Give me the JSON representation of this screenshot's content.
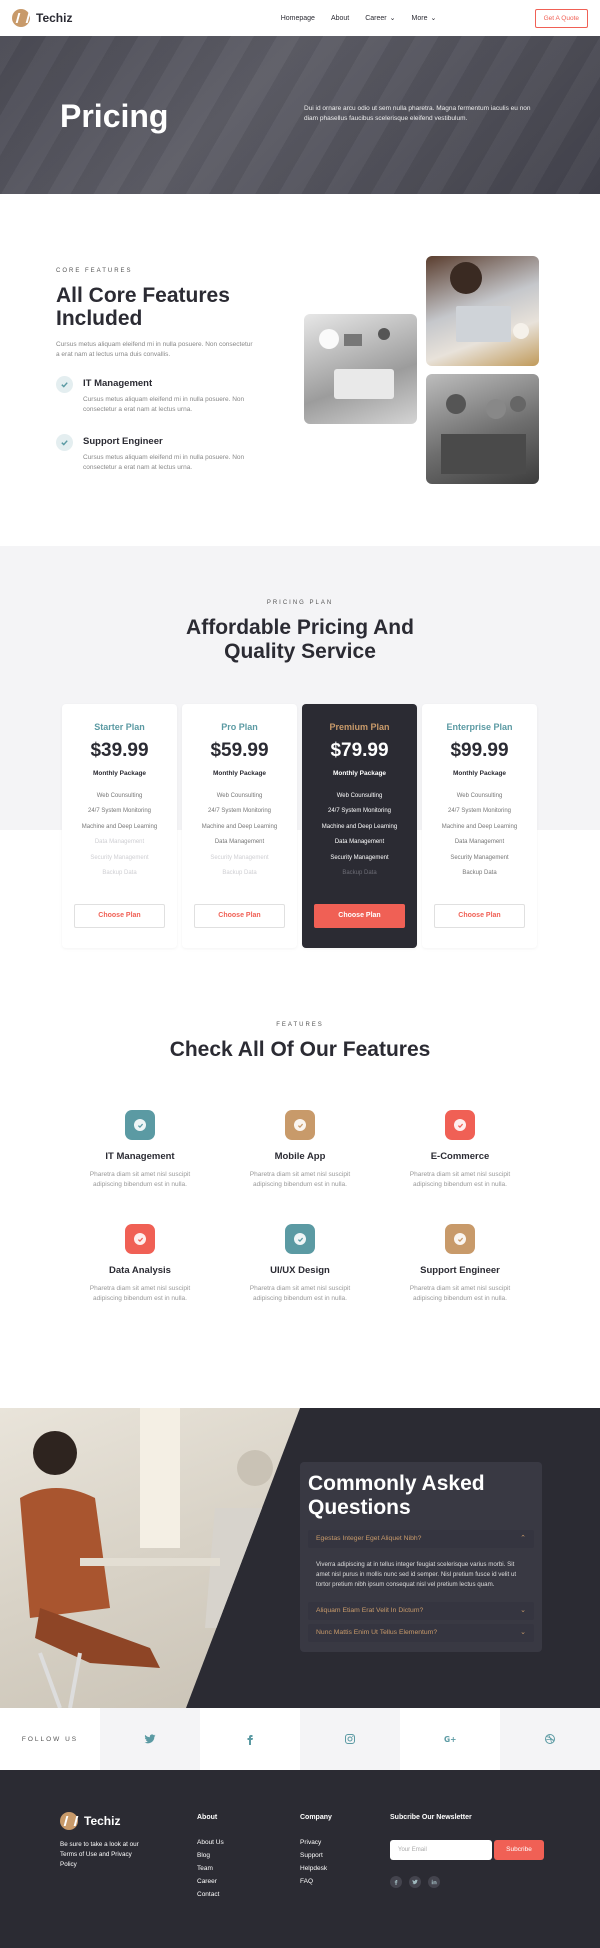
{
  "header": {
    "brand": "Techiz",
    "nav": [
      "Homepage",
      "About",
      "Career",
      "More"
    ],
    "cta": "Get A Quote"
  },
  "hero": {
    "title": "Pricing",
    "subtitle": "Dui id ornare arcu odio ut sem nulla pharetra. Magna fermentum iaculis eu non diam phasellus faucibus scelerisque eleifend vestibulum."
  },
  "core": {
    "eyebrow": "CORE FEATURES",
    "title": "All Core Features Included",
    "description": "Cursus metus aliquam eleifend mi in nulla posuere. Non consectetur a erat nam at lectus urna duis convallis.",
    "items": [
      {
        "title": "IT Management",
        "text": "Cursus metus aliquam eleifend mi in nulla posuere. Non consectetur a erat nam at lectus urna."
      },
      {
        "title": "Support Engineer",
        "text": "Cursus metus aliquam eleifend mi in nulla posuere. Non consectetur a erat nam at lectus urna."
      }
    ]
  },
  "pricing": {
    "eyebrow": "PRICING PLAN",
    "title": "Affordable Pricing And Quality Service",
    "plans": [
      {
        "name": "Starter Plan",
        "price": "$39.99",
        "package": "Monthly Package",
        "button": "Choose Plan",
        "features": [
          "Web Counsulting",
          "24/7 System Monitoring",
          "Machine and Deep Learning",
          "Data Management",
          "Security Management",
          "Backup Data"
        ],
        "enabled": [
          true,
          true,
          true,
          false,
          false,
          false
        ]
      },
      {
        "name": "Pro Plan",
        "price": "$59.99",
        "package": "Monthly Package",
        "button": "Choose Plan",
        "features": [
          "Web Counsulting",
          "24/7 System Monitoring",
          "Machine and Deep Learning",
          "Data Management",
          "Security Management",
          "Backup Data"
        ],
        "enabled": [
          true,
          true,
          true,
          true,
          false,
          false
        ]
      },
      {
        "name": "Premium Plan",
        "price": "$79.99",
        "package": "Monthly Package",
        "button": "Choose Plan",
        "features": [
          "Web Counsulting",
          "24/7 System Monitoring",
          "Machine and Deep Learning",
          "Data Management",
          "Security Management",
          "Backup Data"
        ],
        "enabled": [
          true,
          true,
          true,
          true,
          true,
          false
        ]
      },
      {
        "name": "Enterprise Plan",
        "price": "$99.99",
        "package": "Monthly Package",
        "button": "Choose Plan",
        "features": [
          "Web Counsulting",
          "24/7 System Monitoring",
          "Machine and Deep Learning",
          "Data Management",
          "Security Management",
          "Backup Data"
        ],
        "enabled": [
          true,
          true,
          true,
          true,
          true,
          true
        ]
      }
    ]
  },
  "features": {
    "eyebrow": "FEATURES",
    "title": "Check All Of Our Features",
    "items": [
      {
        "title": "IT Management",
        "text": "Pharetra diam sit amet nisl suscipit adipiscing bibendum est in nulla.",
        "color": "#5b9aa3"
      },
      {
        "title": "Mobile App",
        "text": "Pharetra diam sit amet nisl suscipit adipiscing bibendum est in nulla.",
        "color": "#c89a6a"
      },
      {
        "title": "E-Commerce",
        "text": "Pharetra diam sit amet nisl suscipit adipiscing bibendum est in nulla.",
        "color": "#f06055"
      },
      {
        "title": "Data Analysis",
        "text": "Pharetra diam sit amet nisl suscipit adipiscing bibendum est in nulla.",
        "color": "#f06055"
      },
      {
        "title": "UI/UX Design",
        "text": "Pharetra diam sit amet nisl suscipit adipiscing bibendum est in nulla.",
        "color": "#5b9aa3"
      },
      {
        "title": "Support Engineer",
        "text": "Pharetra diam sit amet nisl suscipit adipiscing bibendum est in nulla.",
        "color": "#c89a6a"
      }
    ]
  },
  "faq": {
    "title": "Commonly Asked Questions",
    "questions": [
      {
        "q": "Egestas Integer Eget Aliquet Nibh?",
        "open": true,
        "a": "Viverra adipiscing at in tellus integer feugiat scelerisque varius morbi. Sit amet nisl purus in mollis nunc sed id semper. Nisl pretium fusce id velit ut tortor pretium nibh ipsum consequat nisl vel pretium lectus quam."
      },
      {
        "q": "Aliquam Etiam Erat Velit In Dictum?",
        "open": false
      },
      {
        "q": "Nunc Mattis Enim Ut Tellus Elementum?",
        "open": false
      }
    ]
  },
  "social": {
    "label": "FOLLOW US",
    "icons": [
      "twitter-icon",
      "facebook-icon",
      "instagram-icon",
      "google-plus-icon",
      "dribbble-icon"
    ]
  },
  "footer": {
    "brand": "Techiz",
    "blurb": "Be sure to take a look at our Terms of Use and Privacy Policy",
    "about_title": "About",
    "about_links": [
      "About Us",
      "Blog",
      "Team",
      "Career",
      "Contact"
    ],
    "company_title": "Company",
    "company_links": [
      "Privacy",
      "Support",
      "Helpdesk",
      "FAQ"
    ],
    "newsletter_title": "Subcribe Our Newsletter",
    "email_placeholder": "Your Email",
    "subscribe": "Subcribe",
    "social_icons": [
      "facebook-icon",
      "twitter-icon",
      "linkedin-icon"
    ]
  },
  "colors": {
    "accent": "#f06055",
    "teal": "#5b9aa3",
    "gold": "#c89a6a",
    "dark": "#2b2b33"
  }
}
